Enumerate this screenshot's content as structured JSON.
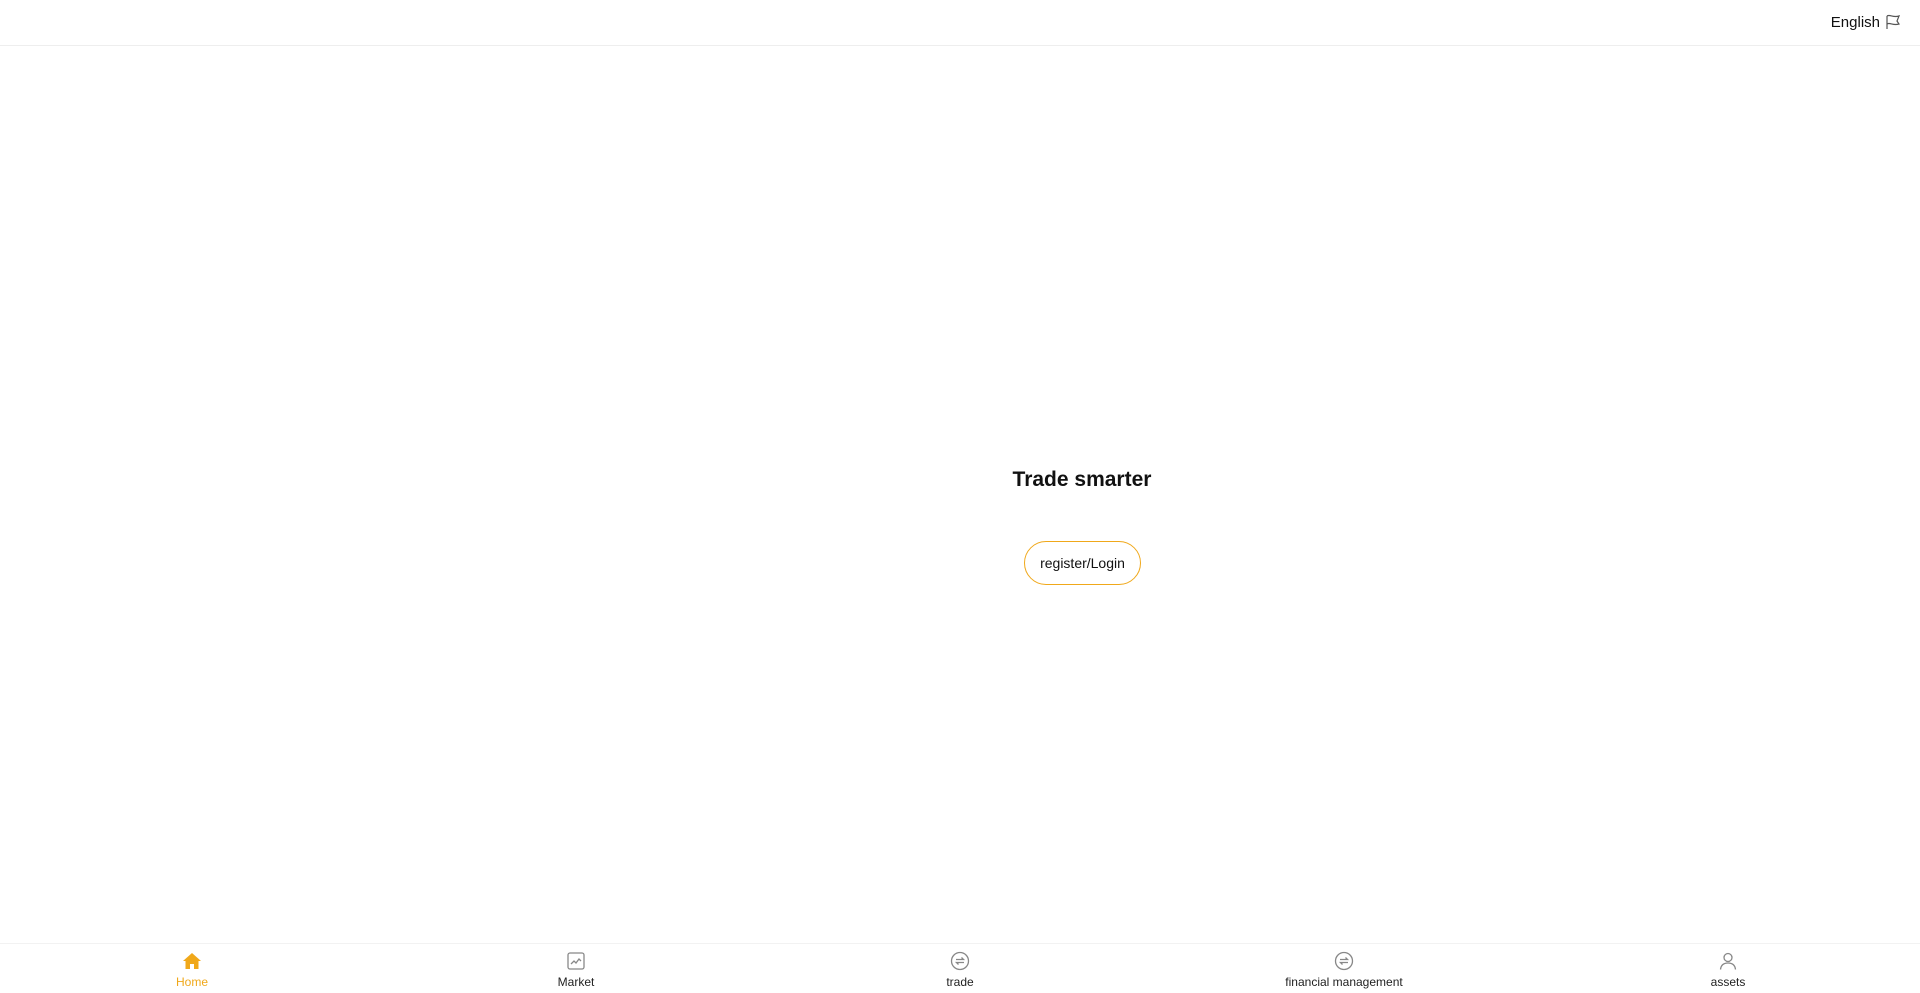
{
  "header": {
    "language_label": "English",
    "language_icon": "flag-icon"
  },
  "hero": {
    "title": "Trade smarter",
    "auth_button_label": "register/Login"
  },
  "tabbar": {
    "accent_color": "#f0a81a",
    "items": [
      {
        "label": "Home",
        "icon": "home-icon",
        "active": true
      },
      {
        "label": "Market",
        "icon": "chart-icon",
        "active": false
      },
      {
        "label": "trade",
        "icon": "exchange-icon",
        "active": false
      },
      {
        "label": "financial management",
        "icon": "exchange-icon",
        "active": false
      },
      {
        "label": "assets",
        "icon": "user-icon",
        "active": false
      }
    ]
  }
}
